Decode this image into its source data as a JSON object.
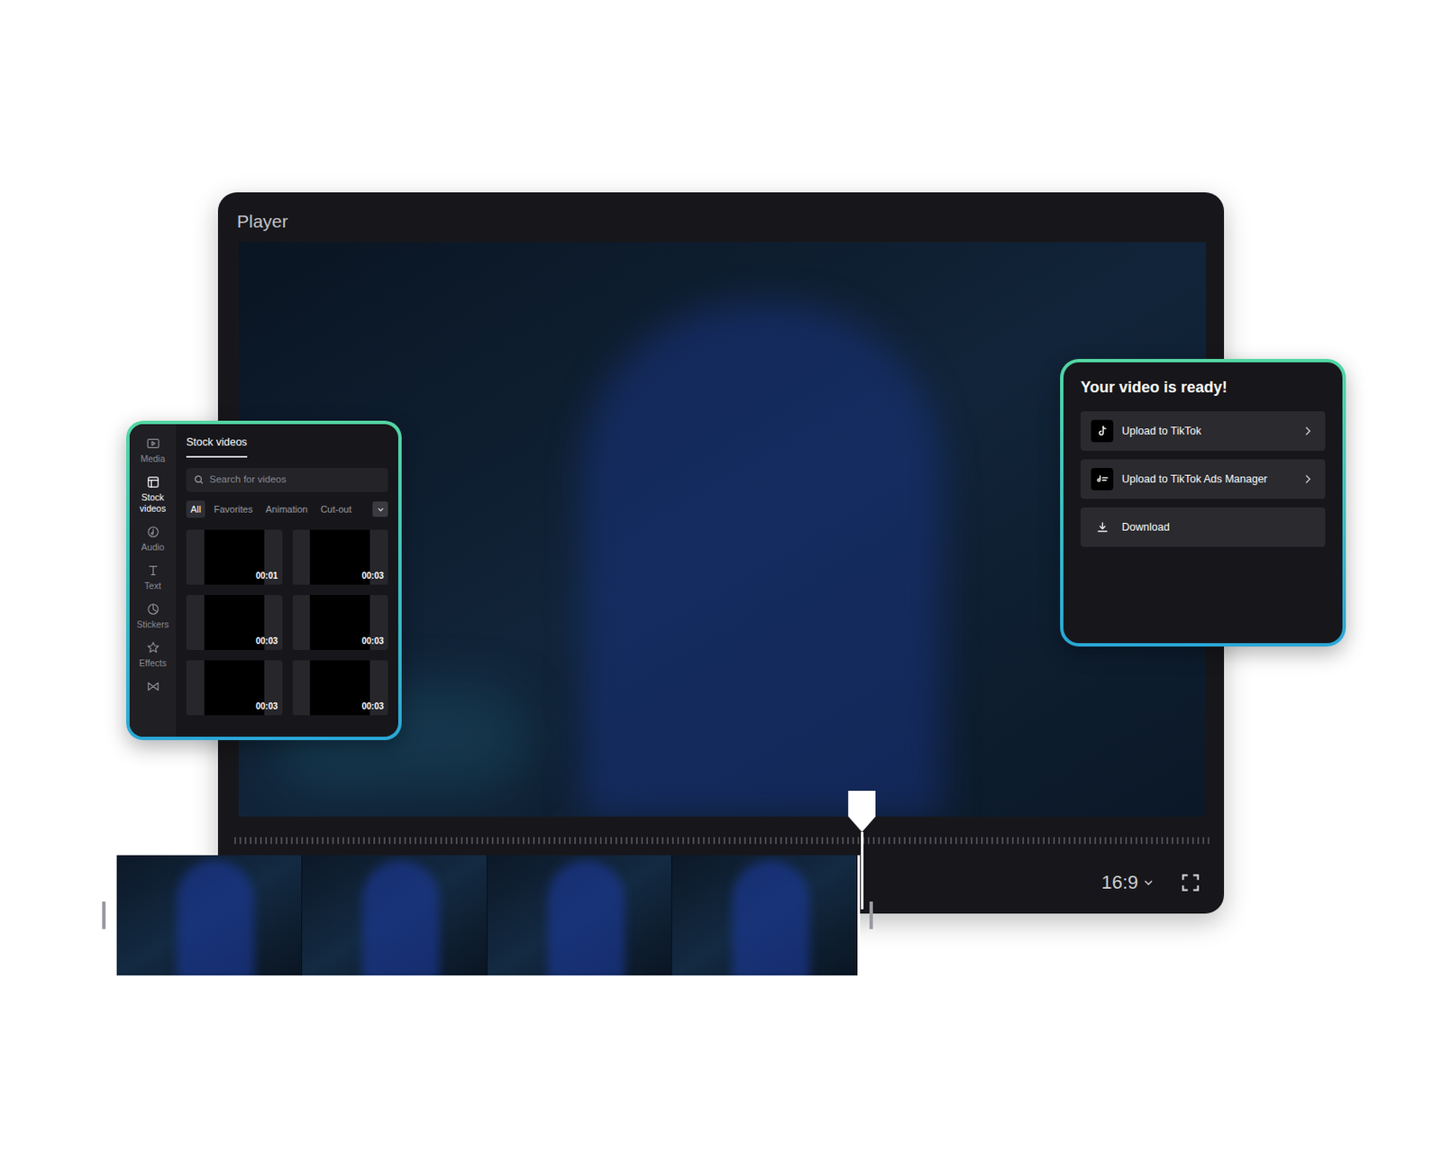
{
  "player": {
    "title": "Player",
    "aspect_ratio": "16:9",
    "playhead": {
      "level": 0.642
    }
  },
  "media_panel": {
    "sidebar": [
      {
        "label": "Media",
        "kind": "media",
        "selected": false
      },
      {
        "label": "Stock videos",
        "kind": "stock",
        "selected": true
      },
      {
        "label": "Audio",
        "kind": "audio",
        "selected": false
      },
      {
        "label": "Text",
        "kind": "text",
        "selected": false
      },
      {
        "label": "Stickers",
        "kind": "stickers",
        "selected": false
      },
      {
        "label": "Effects",
        "kind": "effects",
        "selected": false
      }
    ],
    "tab": "Stock videos",
    "search": {
      "placeholder": "Search for videos"
    },
    "filters": [
      {
        "label": "All",
        "selected": true
      },
      {
        "label": "Favorites",
        "selected": false
      },
      {
        "label": "Animation",
        "selected": false
      },
      {
        "label": "Cut-out",
        "selected": false
      }
    ],
    "thumbnails": [
      {
        "duration": "00:01"
      },
      {
        "duration": "00:03"
      },
      {
        "duration": "00:03"
      },
      {
        "duration": "00:03"
      },
      {
        "duration": "00:03"
      },
      {
        "duration": "00:03"
      }
    ]
  },
  "export": {
    "title": "Your video is ready!",
    "actions": [
      {
        "label": "Upload to TikTok",
        "kind": "tiktok"
      },
      {
        "label": "Upload to TikTok Ads Manager",
        "kind": "ads"
      },
      {
        "label": "Download",
        "kind": "download"
      }
    ]
  }
}
